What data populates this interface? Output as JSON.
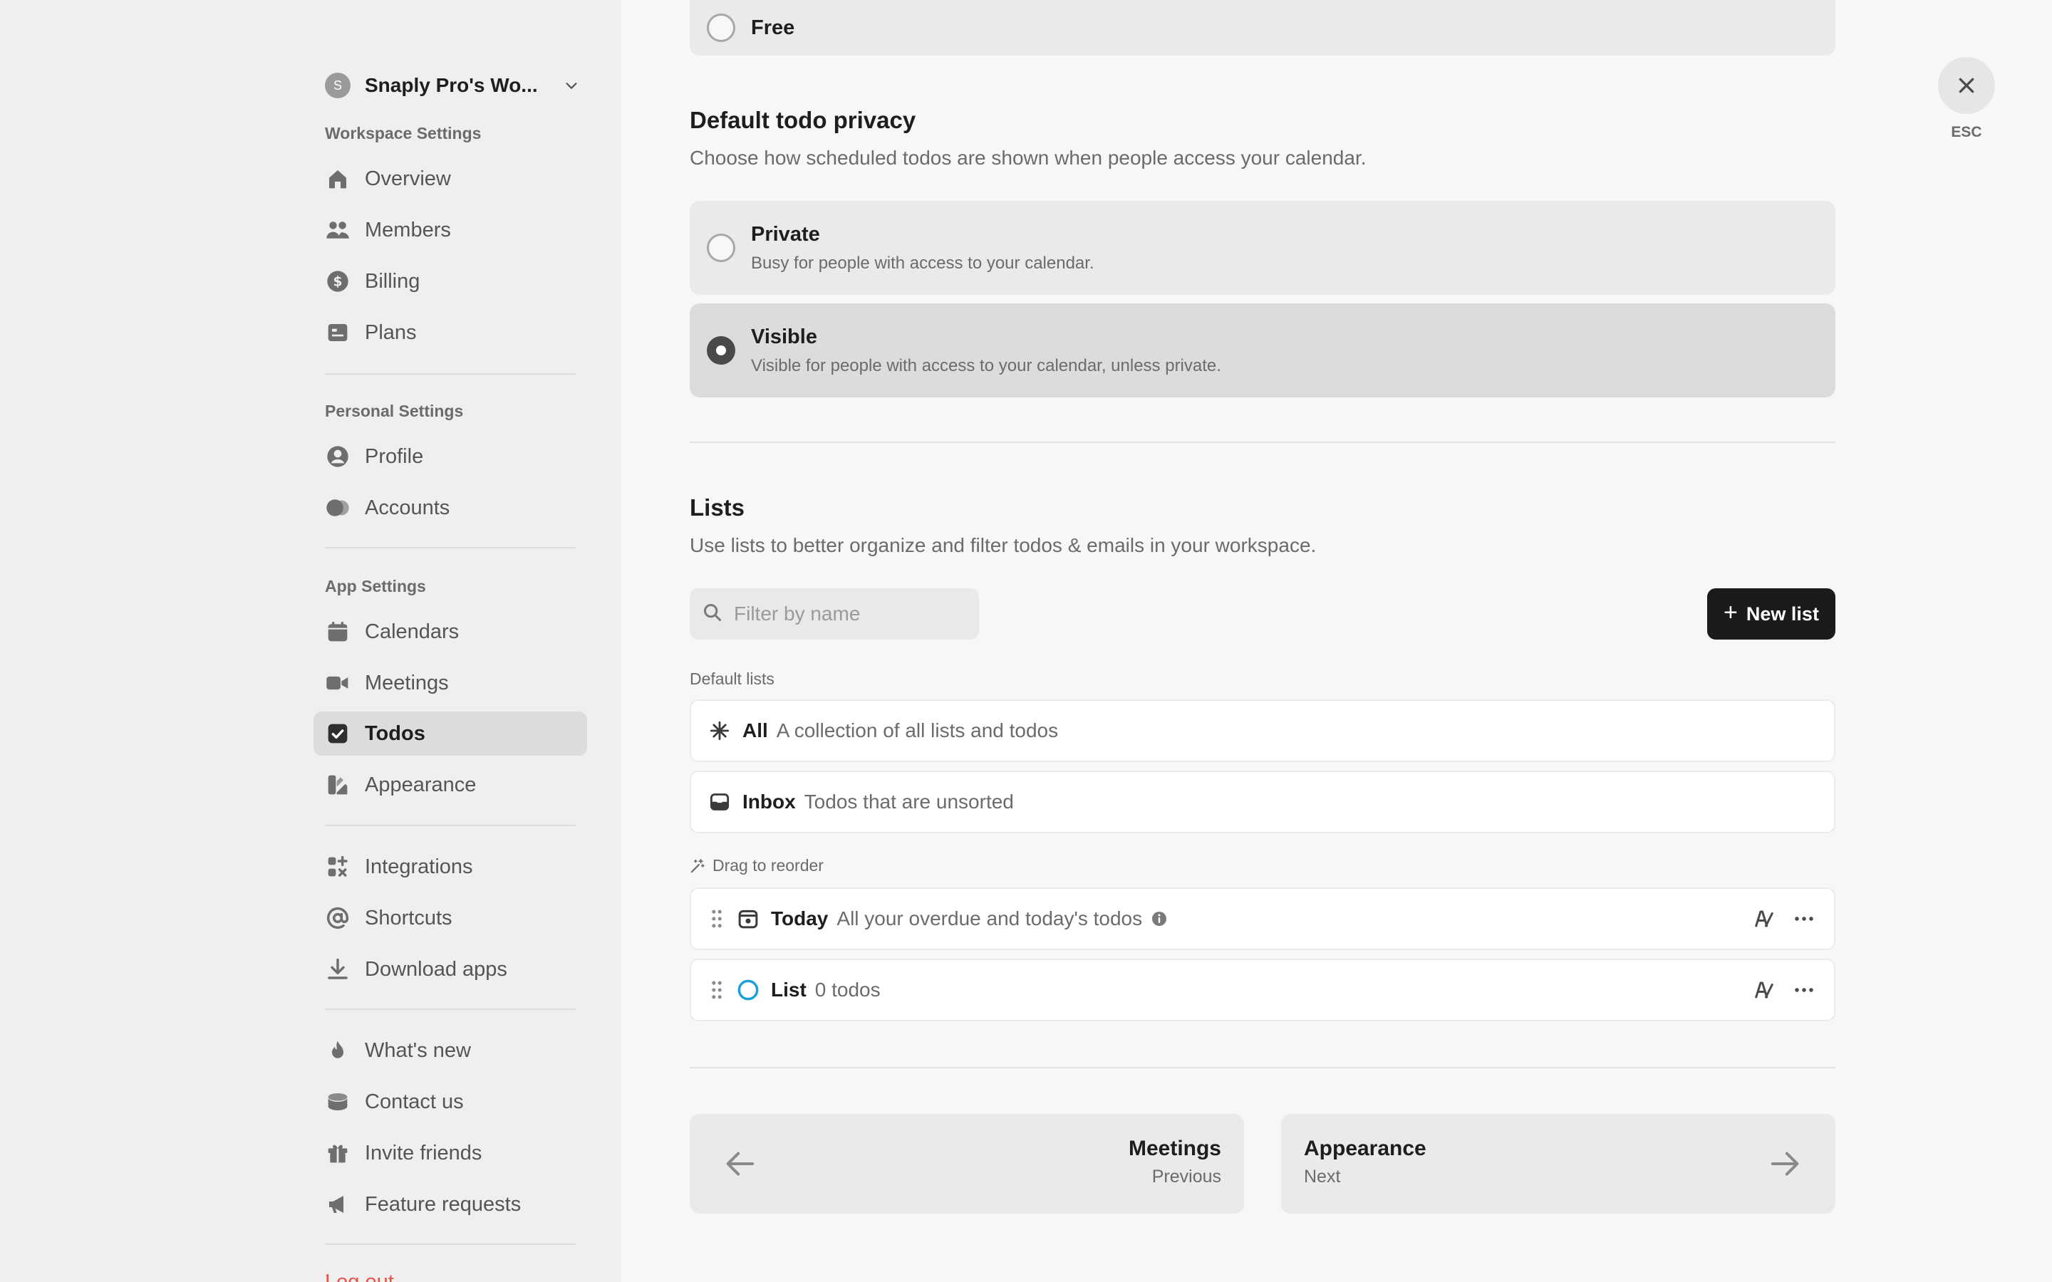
{
  "sidebar": {
    "workspace": {
      "avatar_letter": "S",
      "name": "Snaply Pro's Wo..."
    },
    "sections": {
      "workspace": "Workspace Settings",
      "personal": "Personal Settings",
      "app": "App Settings"
    },
    "items": {
      "overview": "Overview",
      "members": "Members",
      "billing": "Billing",
      "plans": "Plans",
      "profile": "Profile",
      "accounts": "Accounts",
      "calendars": "Calendars",
      "meetings": "Meetings",
      "todos": "Todos",
      "appearance": "Appearance",
      "integrations": "Integrations",
      "shortcuts": "Shortcuts",
      "download_apps": "Download apps",
      "whats_new": "What's new",
      "contact_us": "Contact us",
      "invite_friends": "Invite friends",
      "feature_requests": "Feature requests",
      "logout": "Log out"
    },
    "active_item": "Todos"
  },
  "main": {
    "free_option": "Free",
    "privacy": {
      "title": "Default todo privacy",
      "description": "Choose how scheduled todos are shown when people access your calendar.",
      "options": [
        {
          "title": "Private",
          "subtitle": "Busy for people with access to your calendar.",
          "selected": false
        },
        {
          "title": "Visible",
          "subtitle": "Visible for people with access to your calendar, unless private.",
          "selected": true
        }
      ]
    },
    "lists": {
      "title": "Lists",
      "description": "Use lists to better organize and filter todos & emails in your workspace.",
      "filter_placeholder": "Filter by name",
      "new_list_label": "New list",
      "default_label": "Default lists",
      "defaults": [
        {
          "name": "All",
          "desc": "A collection of all lists and todos"
        },
        {
          "name": "Inbox",
          "desc": "Todos that are unsorted"
        }
      ],
      "drag_label": "Drag to reorder",
      "custom": [
        {
          "name": "Today",
          "desc": "All your overdue and today's todos"
        },
        {
          "name": "List",
          "desc": "0 todos"
        }
      ]
    },
    "pagination": {
      "prev": {
        "title": "Meetings",
        "sub": "Previous"
      },
      "next": {
        "title": "Appearance",
        "sub": "Next"
      }
    }
  },
  "close": {
    "esc_label": "ESC"
  },
  "colors": {
    "accent_list_circle": "#1a9fd8",
    "logout": "#e2574c",
    "primary_button": "#1b1b1b"
  }
}
